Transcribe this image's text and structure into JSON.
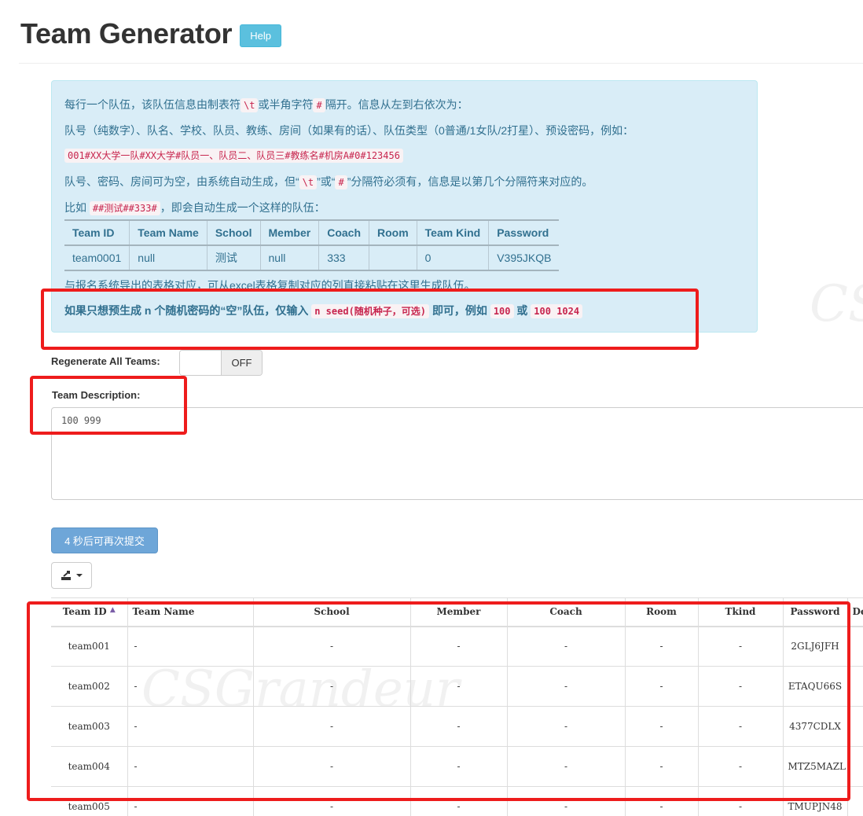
{
  "header": {
    "title": "Team Generator",
    "help_label": "Help"
  },
  "info": {
    "line1_a": "每行一个队伍，该队伍信息由制表符",
    "line1_code1": "\\t",
    "line1_b": "或半角字符",
    "line1_code2": "#",
    "line1_c": "隔开。信息从左到右依次为：",
    "line2": "队号（纯数字）、队名、学校、队员、教练、房间（如果有的话）、队伍类型（0普通/1女队/2打星）、预设密码，例如：",
    "line3_code": "001#XX大学一队#XX大学#队员一、队员二、队员三#教练名#机房A#0#123456",
    "line4_a": "队号、密码、房间可为空，由系统自动生成，但“",
    "line4_code1": "\\t",
    "line4_b": "”或“",
    "line4_code2": "#",
    "line4_c": "”分隔符必须有，信息是以第几个分隔符来对应的。",
    "line5_a": "比如",
    "line5_code": "##测试##333#",
    "line5_b": "，即会自动生成一个这样的队伍：",
    "example_table": {
      "headers": [
        "Team ID",
        "Team Name",
        "School",
        "Member",
        "Coach",
        "Room",
        "Team Kind",
        "Password"
      ],
      "row": [
        "team0001",
        "null",
        "测试",
        "null",
        "333",
        "",
        "0",
        "V395JKQB"
      ]
    },
    "line6": "与报名系统导出的表格对应，可从excel表格复制对应的列直接粘贴在这里生成队伍。",
    "line7_a": "如果只想预生成 n 个随机密码的“空”队伍，仅输入",
    "line7_code1": "n seed(随机种子，可选)",
    "line7_b": "即可，例如",
    "line7_code2": "100",
    "line7_c": "或",
    "line7_code3": "100 1024"
  },
  "regenerate": {
    "label": "Regenerate All Teams:",
    "state": "OFF"
  },
  "description": {
    "label": "Team Description:",
    "value": "100 999"
  },
  "submit": {
    "label": "4 秒后可再次提交"
  },
  "teams_table": {
    "headers": [
      "Team ID",
      "Team Name",
      "School",
      "Member",
      "Coach",
      "Room",
      "Tkind",
      "Password",
      "De"
    ],
    "rows": [
      [
        "team001",
        "-",
        "-",
        "-",
        "-",
        "-",
        "-",
        "2GLJ6JFH"
      ],
      [
        "team002",
        "-",
        "-",
        "-",
        "-",
        "-",
        "-",
        "ETAQU66S"
      ],
      [
        "team003",
        "-",
        "-",
        "-",
        "-",
        "-",
        "-",
        "4377CDLX"
      ],
      [
        "team004",
        "-",
        "-",
        "-",
        "-",
        "-",
        "-",
        "MTZ5MAZL"
      ],
      [
        "team005",
        "-",
        "-",
        "-",
        "-",
        "-",
        "-",
        "TMUPJN48"
      ]
    ]
  },
  "watermark": {
    "text": "CSGrandeur",
    "short": "CS"
  },
  "colors": {
    "annotation": "#ee1c1c",
    "info_bg": "#d9edf7",
    "info_text": "#31708f",
    "help_btn": "#5bc0de",
    "submit_btn": "#6ea6d8"
  }
}
